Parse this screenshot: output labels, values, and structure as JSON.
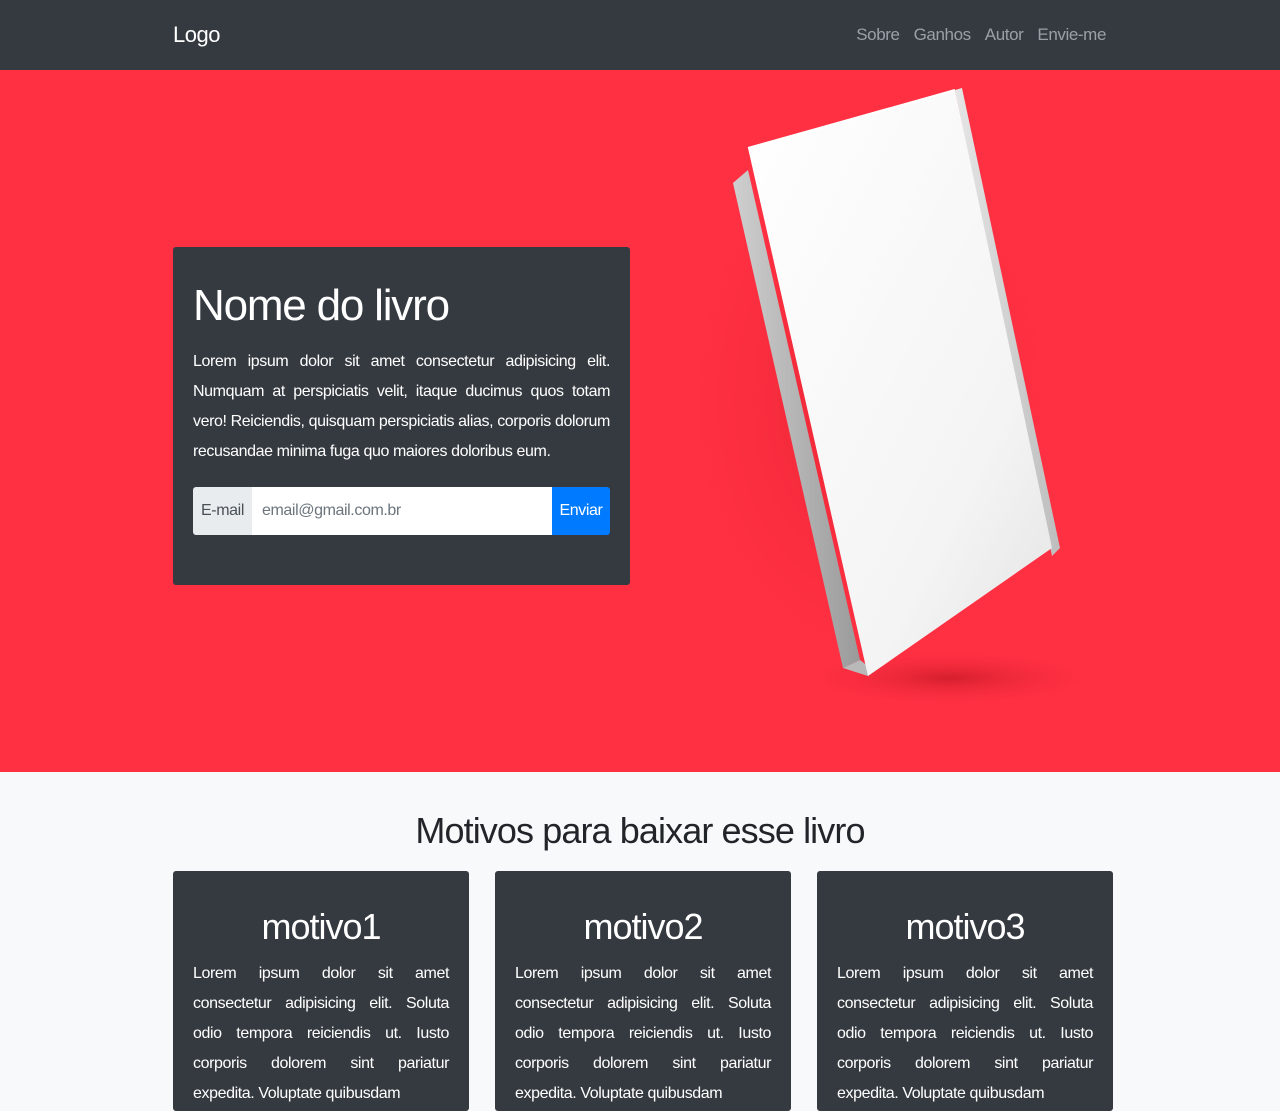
{
  "navbar": {
    "logo": "Logo",
    "links": [
      {
        "label": "Sobre"
      },
      {
        "label": "Ganhos"
      },
      {
        "label": "Autor"
      },
      {
        "label": "Envie-me"
      }
    ]
  },
  "hero": {
    "title": "Nome do livro",
    "text": "Lorem ipsum dolor sit amet consectetur adipisicing elit. Numquam at perspiciatis velit, itaque ducimus quos totam vero! Reiciendis, quisquam perspiciatis alias, corporis dolorum recusandae minima fuga quo maiores doloribus eum.",
    "form": {
      "label": "E-mail",
      "placeholder": "email@gmail.com.br",
      "button": "Enviar"
    }
  },
  "reasons": {
    "title": "Motivos para baixar esse livro",
    "cards": [
      {
        "title": "motivo1",
        "text": "Lorem ipsum dolor sit amet consectetur adipisicing elit. Soluta odio tempora reiciendis ut. Iusto corporis dolorem sint pariatur expedita. Voluptate quibusdam"
      },
      {
        "title": "motivo2",
        "text": "Lorem ipsum dolor sit amet consectetur adipisicing elit. Soluta odio tempora reiciendis ut. Iusto corporis dolorem sint pariatur expedita. Voluptate quibusdam"
      },
      {
        "title": "motivo3",
        "text": "Lorem ipsum dolor sit amet consectetur adipisicing elit. Soluta odio tempora reiciendis ut. Iusto corporis dolorem sint pariatur expedita. Voluptate quibusdam"
      }
    ]
  },
  "colors": {
    "navbar": "#343a40",
    "hero_background": "#ff3042",
    "card_background": "#343a40",
    "button": "#007bff",
    "section_background": "#f8f9fa"
  }
}
